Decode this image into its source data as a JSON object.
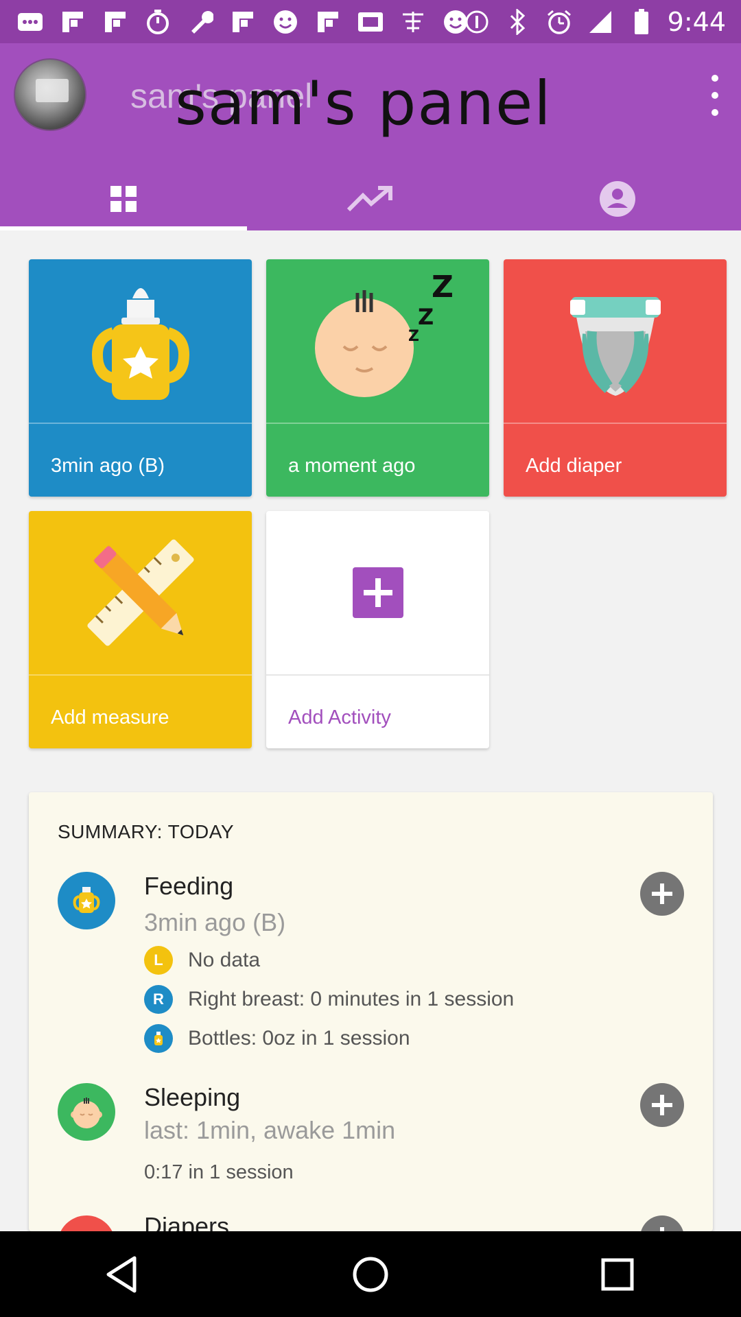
{
  "status_bar": {
    "time": "9:44",
    "icons": [
      "message-icon",
      "flipboard-icon",
      "flipboard-icon",
      "stopwatch-icon",
      "wrench-icon",
      "flipboard-icon",
      "smiley-icon",
      "flipboard-icon",
      "qt-icon",
      "app-icon",
      "smiley-icon",
      "info-icon",
      "bluetooth-icon",
      "alarm-icon",
      "signal-icon",
      "battery-icon"
    ]
  },
  "app_bar": {
    "title": "sam's panel",
    "overlay_text": "sam's panel",
    "tabs": [
      {
        "name": "dashboard-icon"
      },
      {
        "name": "trend-icon"
      },
      {
        "name": "profile-icon"
      }
    ],
    "active_tab": 0
  },
  "tiles": [
    {
      "label": "3min ago (B)",
      "icon": "sippy-cup-icon",
      "color": "#1e8cc6"
    },
    {
      "label": "a moment ago",
      "icon": "sleeping-baby-icon",
      "color": "#3cb85f"
    },
    {
      "label": "Add diaper",
      "icon": "diaper-icon",
      "color": "#f0504a"
    },
    {
      "label": "Add measure",
      "icon": "ruler-pencil-icon",
      "color": "#f3c20f"
    },
    {
      "label": "Add Activity",
      "icon": "plus-icon",
      "color": "#ffffff"
    }
  ],
  "summary": {
    "title": "SUMMARY: TODAY",
    "feeding": {
      "title": "Feeding",
      "subtitle": "3min ago (B)",
      "details": [
        {
          "badge": "L",
          "text": "No data"
        },
        {
          "badge": "R",
          "text": "Right breast: 0 minutes in 1 session"
        },
        {
          "badge": "",
          "text": "Bottles: 0oz in 1 session"
        }
      ]
    },
    "sleeping": {
      "title": "Sleeping",
      "subtitle": "last: 1min, awake 1min",
      "line": "0:17 in 1 session"
    },
    "diapers": {
      "title": "Diapers"
    }
  }
}
